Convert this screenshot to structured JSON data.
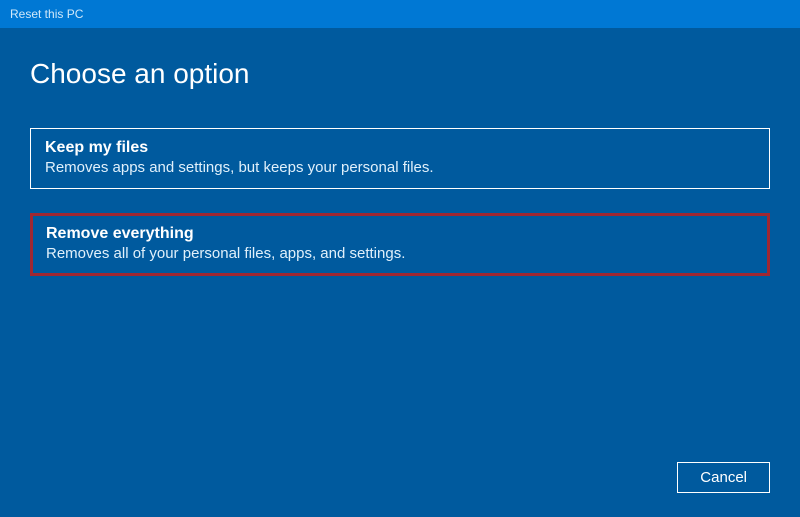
{
  "titlebar": {
    "title": "Reset this PC"
  },
  "page": {
    "heading": "Choose an option"
  },
  "options": [
    {
      "title": "Keep my files",
      "description": "Removes apps and settings, but keeps your personal files."
    },
    {
      "title": "Remove everything",
      "description": "Removes all of your personal files, apps, and settings."
    }
  ],
  "footer": {
    "cancel_label": "Cancel"
  }
}
